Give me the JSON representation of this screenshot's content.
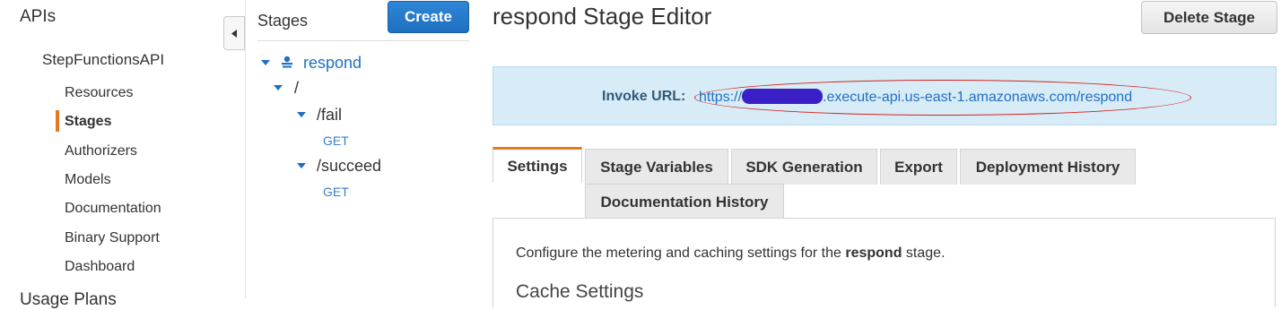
{
  "nav": {
    "apis": "APIs",
    "api_name": "StepFunctionsAPI",
    "items": [
      {
        "label": "Resources"
      },
      {
        "label": "Stages"
      },
      {
        "label": "Authorizers"
      },
      {
        "label": "Models"
      },
      {
        "label": "Documentation"
      },
      {
        "label": "Binary Support"
      },
      {
        "label": "Dashboard"
      }
    ],
    "active_item": "Stages",
    "cutoff_label": "Usage Plans"
  },
  "stages": {
    "title": "Stages",
    "create_label": "Create",
    "tree": {
      "stage": "respond",
      "root": "/",
      "fail_path": "/fail",
      "fail_method": "GET",
      "succeed_path": "/succeed",
      "succeed_method": "GET"
    }
  },
  "editor": {
    "title": "respond Stage Editor",
    "delete_label": "Delete Stage",
    "invoke_label": "Invoke URL:",
    "invoke_url_prefix": "https://",
    "invoke_url_suffix": ".execute-api.us-east-1.amazonaws.com/respond",
    "tabs": [
      "Settings",
      "Stage Variables",
      "SDK Generation",
      "Export",
      "Deployment History",
      "Documentation History"
    ],
    "active_tab": "Settings",
    "description_prefix": "Configure the metering and caching settings for the",
    "description_bold": "respond",
    "description_suffix": "stage.",
    "section_title": "Cache Settings"
  },
  "colors": {
    "accent_orange": "#e07b1f",
    "link_blue": "#1f6fc5",
    "primary_button": "#1e6fc0",
    "info_box": "#d8ecf7",
    "annotation_red": "#d2231c",
    "redaction": "#3a1fc7"
  }
}
